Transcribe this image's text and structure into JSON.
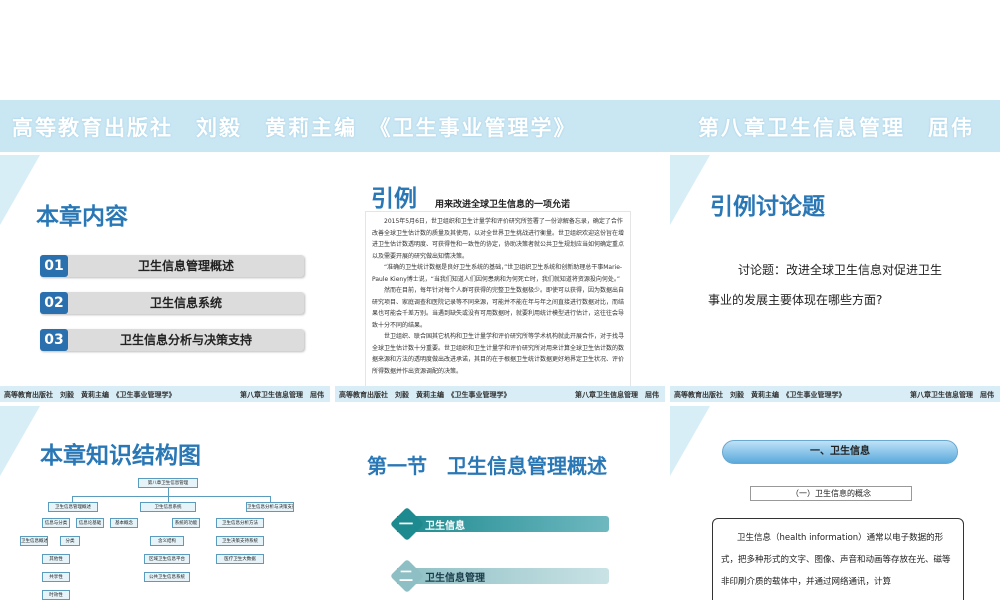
{
  "banner": {
    "left": "高等教育出版社　刘毅　黄莉主编　《卫生事业管理学》",
    "right": "第八章卫生信息管理　屈伟"
  },
  "footer": {
    "left": "高等教育出版社　刘毅　黄莉主编　《卫生事业管理学》",
    "right": "第八章卫生信息管理　屈伟"
  },
  "slide1": {
    "title": "本章内容",
    "items": [
      {
        "num": "01",
        "label": "卫生信息管理概述"
      },
      {
        "num": "02",
        "label": "卫生信息系统"
      },
      {
        "num": "03",
        "label": "卫生信息分析与决策支持"
      }
    ]
  },
  "slide2": {
    "title": "引例",
    "article_title": "用来改进全球卫生信息的一项允诺",
    "paragraphs": [
      "2015年5月6日，世卫组织和卫生计量学和评价研究所签署了一份谅解备忘录，确定了合作改善全球卫生估计数的质量及其使用，以对全世界卫生挑战进行衡量。世卫组织欢迎这份旨在增进卫生估计数透明度、可获得性和一致性的协定，协助决策者就公共卫生规划应当如何确定重点以及需要开展的研究做出知情决策。",
      "“准确的卫生统计数据是良好卫生系统的基础，”世卫组织卫生系统和创新助理总干事Marie-Paule Kieny博士说，“当我们知道人们因何患病和为何死亡时，我们就知道将资源投向何处。”",
      "然而在目前，每年针对每个人群可获得的完整卫生数据极少。即使可以获得，因为数据出自研究项目、家庭调查和医院记录等不同来源，可能并不能在年与年之间直接进行数据对比，而结果也可能会千差万别。当遇到缺失或没有可用数据时，就要利用统计模型进行估计，这往往会导致十分不同的结果。",
      "世卫组织、联合国其它机构和卫生计量学和评价研究所等学术机构就此开展合作，对于找寻全球卫生估计数十分重要。世卫组织和卫生计量学和评价研究所对用来计算全球卫生估计数的数据来源和方法的透明度做出改进承诺，其目的在于根据卫生统计数据更好地界定卫生状况、评价所得数据并作出资源调配的决策。"
    ]
  },
  "slide3": {
    "title": "引例讨论题",
    "line1": "讨论题：改进全球卫生信息对促进卫生",
    "line2": "事业的发展主要体现在哪些方面?"
  },
  "slide4": {
    "title": "本章知识结构图",
    "root": "第八章卫生信息管理",
    "branches": [
      {
        "label": "卫生信息管理概述",
        "children": [
          "信息与分类",
          "信息论基础"
        ]
      },
      {
        "label": "卫生信息系统",
        "children": [
          "基本概念",
          "系统的功能"
        ]
      },
      {
        "label": "卫生信息分析与决策支持",
        "children": [
          "卫生信息分析方法"
        ]
      }
    ],
    "sub_left": [
      "卫生信息概述",
      "分类",
      "其他性",
      "共享性",
      "时效性"
    ],
    "sub_mid": [
      "含义结构",
      "区域卫生信息平台",
      "公共卫生信息系统"
    ],
    "sub_right": [
      "卫生决策支持系统",
      "医疗卫生大数据"
    ]
  },
  "slide5": {
    "title": "第一节　卫生信息管理概述",
    "items": [
      {
        "glyph": "一",
        "label": "卫生信息",
        "color": "#1c8a8f"
      },
      {
        "glyph": "二",
        "label": "卫生信息管理",
        "color": "#8dbfc4"
      }
    ]
  },
  "slide6": {
    "pill": "一、卫生信息",
    "sub": "（一）卫生信息的概念",
    "text": "卫生信息（health information）通常以电子数据的形式，把多种形式的文字、图像、声音和动画等存放在光、磁等非印刷介质的载体中，并通过网络通讯，计算"
  },
  "colors": {
    "banner": "#c9e6f3",
    "title_blue": "#2a77b6",
    "num_blue": "#2a6fae",
    "teal": "#21808a"
  }
}
